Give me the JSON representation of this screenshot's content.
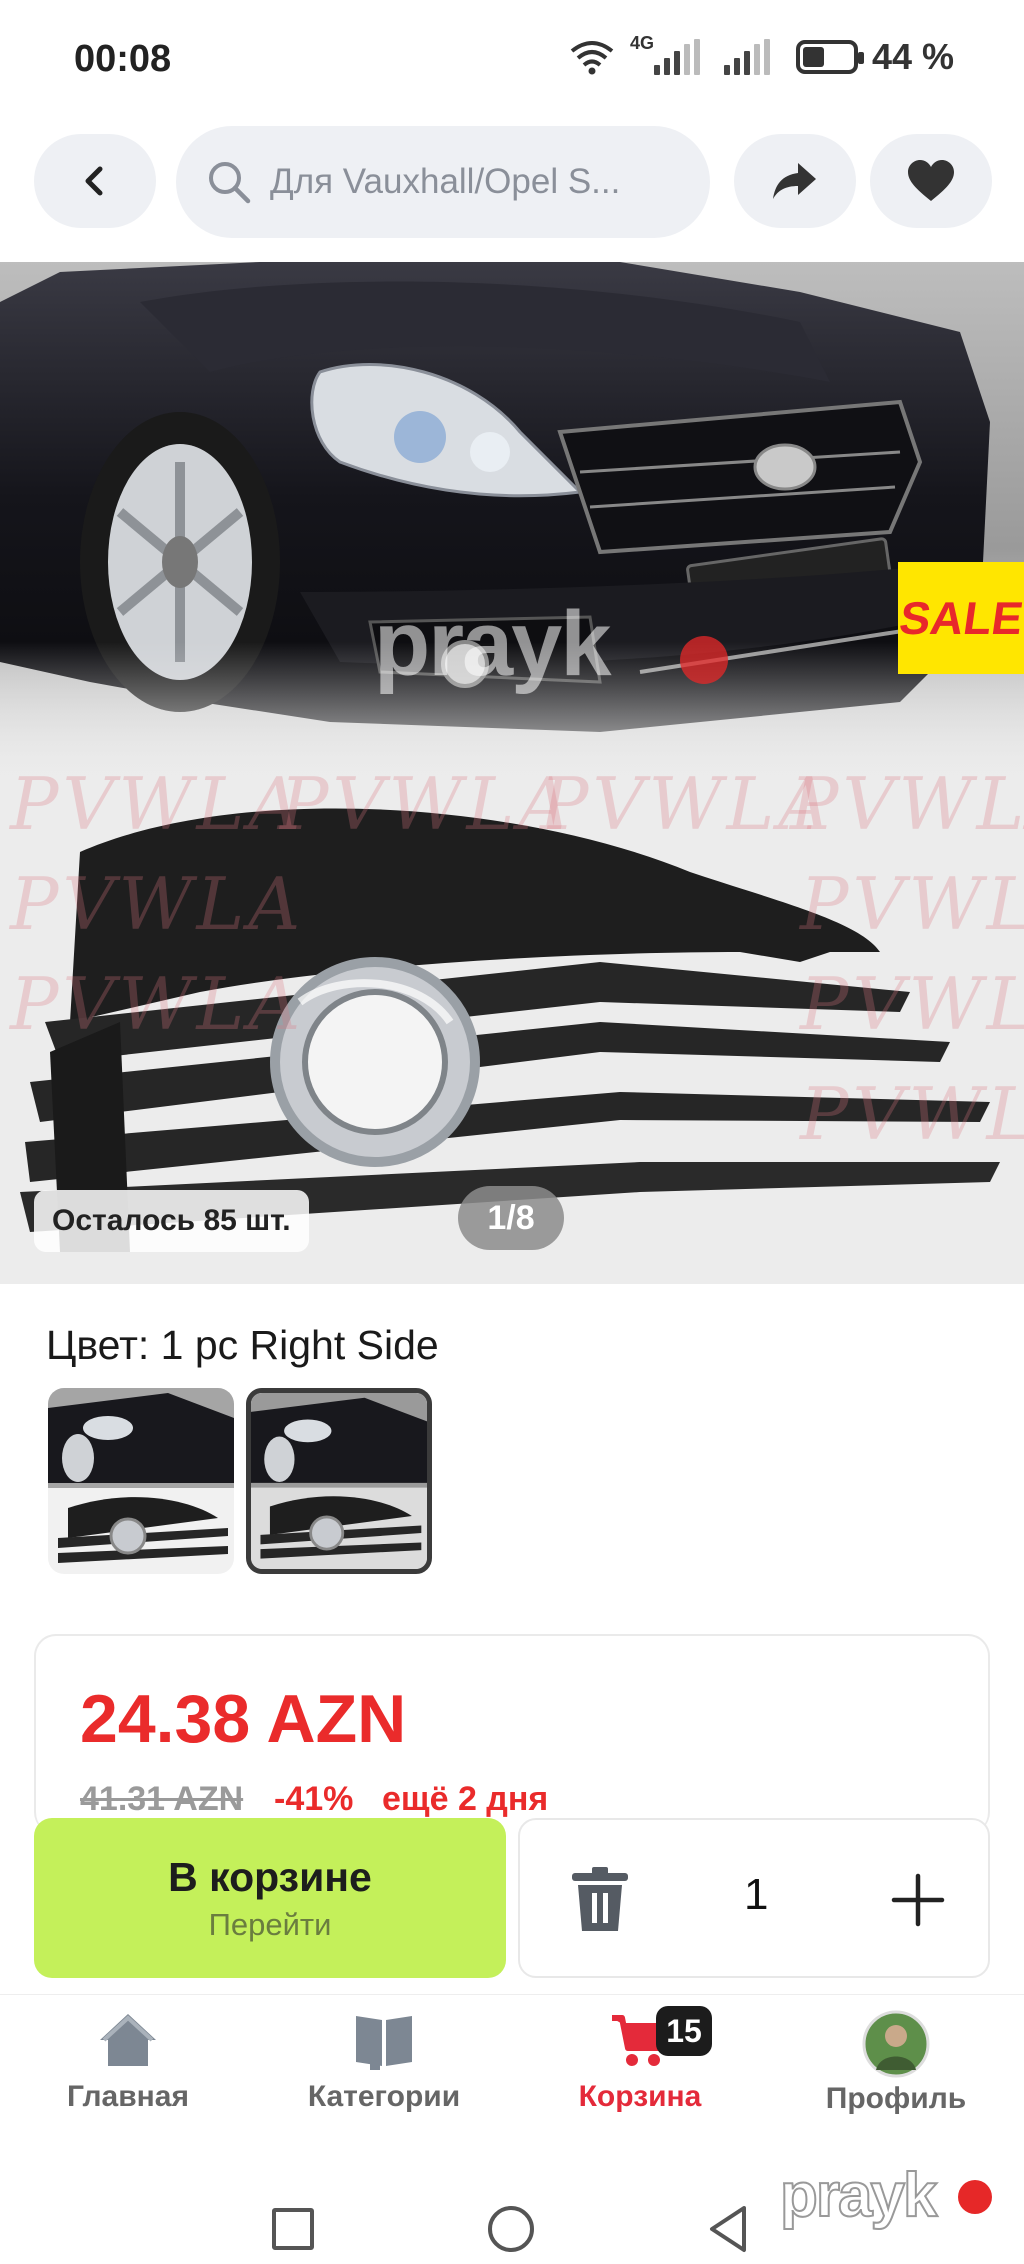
{
  "status_bar": {
    "time": "00:08",
    "network": "4G",
    "battery": "44 %",
    "battery_level": 0.44
  },
  "search": {
    "placeholder": "Для Vauxhall/Opel S..."
  },
  "gallery": {
    "sale_badge": "SALE",
    "watermark": "PVWLA",
    "brand_watermark": "prayk",
    "stock_text": "Осталось 85 шт.",
    "counter": "1/8"
  },
  "color": {
    "label": "Цвет: 1 pc Right Side",
    "options_count": 2,
    "selected_index": 1
  },
  "price": {
    "current": "24.38 AZN",
    "old": "41.31 AZN",
    "discount": "-41%",
    "timer": "ещё 2 дня"
  },
  "cart": {
    "button_title": "В корзине",
    "button_subtitle": "Перейти",
    "quantity": "1"
  },
  "bottom_nav": {
    "items": [
      {
        "label": "Главная",
        "icon": "home-icon"
      },
      {
        "label": "Категории",
        "icon": "catalog-icon"
      },
      {
        "label": "Корзина",
        "icon": "cart-icon",
        "badge": "15",
        "active": true
      },
      {
        "label": "Профиль",
        "icon": "avatar"
      }
    ]
  },
  "branding": {
    "corner_logo": "prayk"
  },
  "colors": {
    "accent_red": "#ea2b2b",
    "cart_green": "#c4f05a",
    "sale_yellow": "#ffe600"
  }
}
